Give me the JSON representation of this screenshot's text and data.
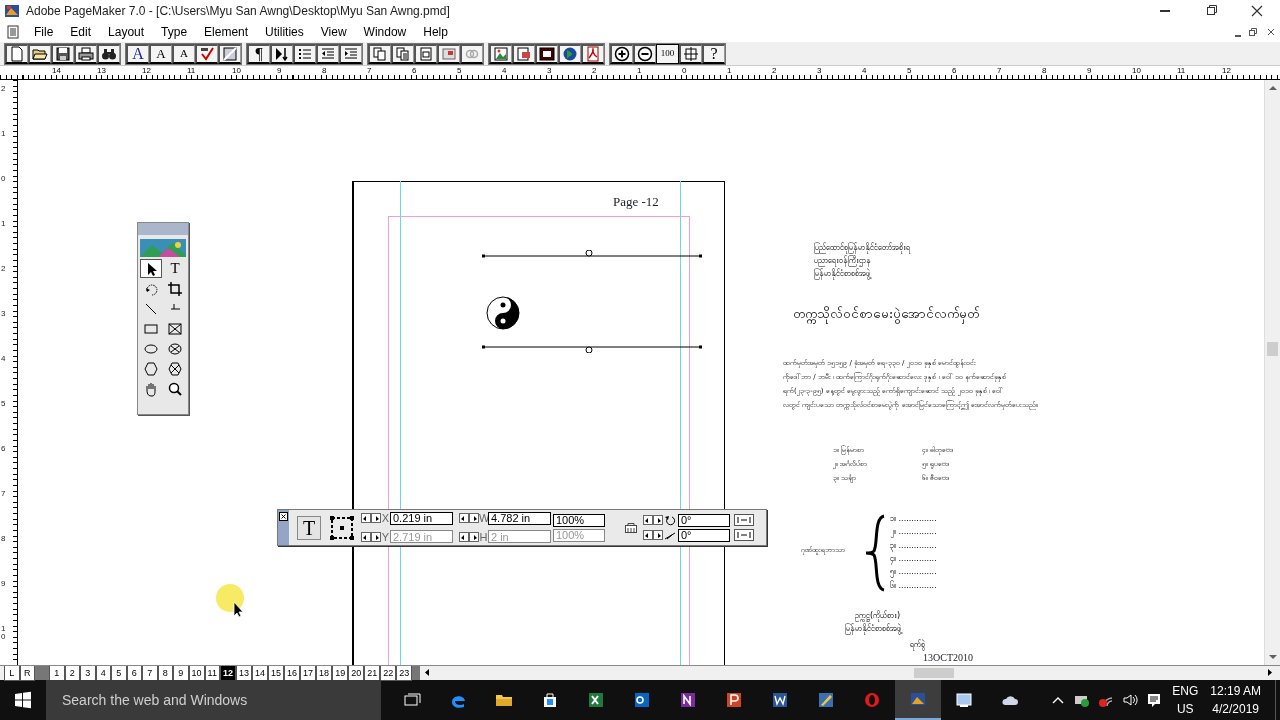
{
  "window": {
    "title": "Adobe PageMaker 7.0 - [C:\\Users\\Myu San Awng\\Desktop\\Myu San Awng.pmd]"
  },
  "menu": [
    "File",
    "Edit",
    "Layout",
    "Type",
    "Element",
    "Utilities",
    "View",
    "Window",
    "Help"
  ],
  "toolbar": [
    [
      {
        "kind": "icon"
      },
      {
        "kind": "icon"
      },
      {
        "kind": "icon"
      },
      {
        "kind": "icon"
      },
      {
        "kind": "icon"
      }
    ],
    [
      {
        "kind": "glyph",
        "label": "A"
      },
      {
        "kind": "glyph",
        "label": "A"
      },
      {
        "kind": "glyph",
        "label": "A"
      },
      {
        "kind": "icon"
      },
      {
        "kind": "icon"
      }
    ],
    [
      {
        "kind": "glyph",
        "label": "¶"
      },
      {
        "kind": "icon"
      },
      {
        "kind": "icon"
      },
      {
        "kind": "icon"
      },
      {
        "kind": "icon"
      }
    ],
    [
      {
        "kind": "icon"
      },
      {
        "kind": "icon"
      },
      {
        "kind": "icon"
      },
      {
        "kind": "icon"
      },
      {
        "kind": "icon"
      }
    ],
    [
      {
        "kind": "icon"
      },
      {
        "kind": "icon"
      },
      {
        "kind": "icon"
      },
      {
        "kind": "icon"
      },
      {
        "kind": "icon"
      }
    ],
    [
      {
        "kind": "icon"
      },
      {
        "kind": "icon"
      },
      {
        "kind": "glyph",
        "label": "100"
      },
      {
        "kind": "icon"
      },
      {
        "kind": "glyph",
        "label": "?"
      }
    ]
  ],
  "ruler": {
    "horizontal": [
      "14",
      "13",
      "12",
      "11",
      "10",
      "9",
      "8",
      "7",
      "6",
      "5",
      "4",
      "3",
      "2",
      "1",
      "0",
      "1",
      "2",
      "3",
      "4",
      "5",
      "6",
      "7",
      "8",
      "9",
      "10",
      "11",
      "12"
    ],
    "vertical": [
      "2",
      "1",
      "0",
      "1",
      "2",
      "3",
      "4",
      "5",
      "6",
      "7",
      "8",
      "9",
      "10"
    ]
  },
  "toolbox": {
    "text_tool": "T"
  },
  "page": {
    "header": "Page -12"
  },
  "pasteboard": {
    "address": [
      "ပြည်ထောင်စုမြန်မာနိုင်ငံတော်အစိုးရ",
      "ပညာရေးဝန်ကြီးဌာန",
      "မြန်မာနိုင်ငံစာစစ်အဖွဲ့"
    ],
    "heading": "တက္ကသိုလ်ဝင်စာမေးပွဲအောင်လက်မှတ်",
    "paragraph": [
      "ထက်မှတ်အမှတ် ၁၅၁၅၉ / ခုံအမှတ် ရေ-၃၃၀ / ၂၀၁၀ ခုနှစ် မောင်ထွန်းဝင်း",
      "ကိုဒေါ်ဘာ / ဘမီး ၊ ထက်ကြောင်ဂိုးရုက်ဂိုးဆောင်လေး ဒုနှစ် ၊ ဝေါ် ၁၀ နက်ဆောင်ခုနှစ်",
      "ရက်(၂၃-၃-၉၅) နေ့တွင် မွေးဖွားသည့် ကော်ရှိကျောင်းဆောင် သည့် ၂၀၁၀ ခုနှစ် ၊ ဝေါ်",
      "လတွင် ကျင်းပသော တက္ကသိုလ်ဝင်စာမေးပွဲကို အောင်မြင်သောကြောင့်ဤ အောင်လက်မှတ်ပေးသည်။"
    ],
    "subjects": [
      "၁။ မြန်မာစာ",
      "၂။ အင်္ဂလိပ်စာ",
      "၃။ သင်္ချာ",
      "၄။ ဓါတုဗေဒ",
      "၅။ ရူပဗေဒ",
      "၆။ ဇီဝဗေဒ"
    ],
    "distinction_label": "ဂုဏ်ထူးရဘာသာ",
    "distinction_lines": [
      "၁။ ...............",
      "၂။ ...............",
      "၃။ ...............",
      "၄။ ...............",
      "၅။ ...............",
      "၆။ ..............."
    ],
    "signature": [
      "ဥက္ကဋ္ဌ(ကိုယ်စား)",
      "မြန်မာနိုင်ငံစာစစ်အဖွဲ့"
    ],
    "date_label": "ရက်စွဲ",
    "date": "13OCT2010"
  },
  "control_palette": {
    "tool": "T",
    "fields": [
      {
        "label": "X",
        "value": "0.219 in",
        "disabled": false
      },
      {
        "label": "Y",
        "value": "2.719 in",
        "disabled": true
      },
      {
        "label": "W",
        "value": "4.782 in",
        "disabled": false
      },
      {
        "label": "H",
        "value": "2 in",
        "disabled": true
      }
    ],
    "scale": [
      {
        "value": "100%",
        "disabled": false
      },
      {
        "value": "100%",
        "disabled": true
      }
    ],
    "angles": [
      "0°",
      "0°"
    ]
  },
  "page_tabs": [
    {
      "label": "L",
      "selected": false
    },
    {
      "label": "R",
      "selected": false
    },
    {
      "label": "1",
      "selected": false
    },
    {
      "label": "2",
      "selected": false
    },
    {
      "label": "3",
      "selected": false
    },
    {
      "label": "4",
      "selected": false
    },
    {
      "label": "5",
      "selected": false
    },
    {
      "label": "6",
      "selected": false
    },
    {
      "label": "7",
      "selected": false
    },
    {
      "label": "8",
      "selected": false
    },
    {
      "label": "9",
      "selected": false
    },
    {
      "label": "10",
      "selected": false
    },
    {
      "label": "11",
      "selected": false
    },
    {
      "label": "12",
      "selected": true
    },
    {
      "label": "13",
      "selected": false
    },
    {
      "label": "14",
      "selected": false
    },
    {
      "label": "15",
      "selected": false
    },
    {
      "label": "16",
      "selected": false
    },
    {
      "label": "17",
      "selected": false
    },
    {
      "label": "18",
      "selected": false
    },
    {
      "label": "19",
      "selected": false
    },
    {
      "label": "20",
      "selected": false
    },
    {
      "label": "21",
      "selected": false
    },
    {
      "label": "22",
      "selected": false
    },
    {
      "label": "23",
      "selected": false
    }
  ],
  "taskbar": {
    "search_placeholder": "Search the web and Windows",
    "language": "ENG",
    "region": "US",
    "time": "12:19 AM",
    "date": "4/2/2019"
  }
}
